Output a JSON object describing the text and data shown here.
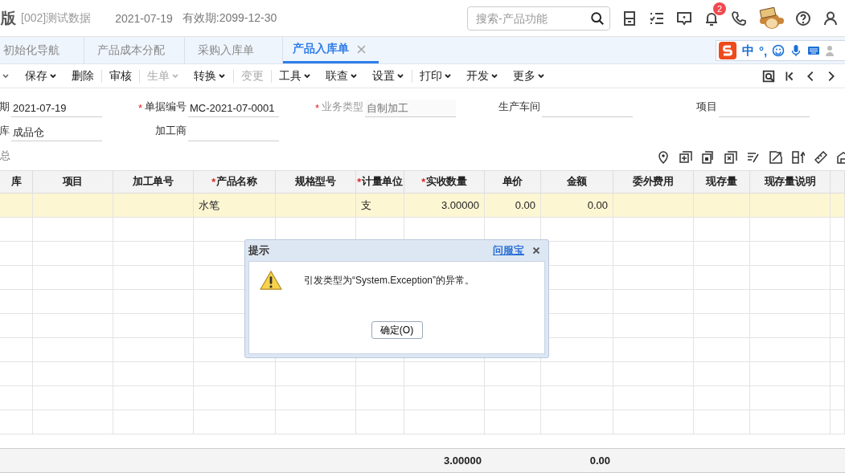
{
  "header": {
    "edition": "版",
    "account": "[002]测试数据",
    "date": "2021-07-19",
    "validity": "有效期:2099-12-30",
    "search": {
      "placeholder": "搜索-产品功能"
    },
    "notification_count": "2"
  },
  "tabs": [
    {
      "label": "初始化导航",
      "selected": false,
      "closable": false
    },
    {
      "label": "产品成本分配",
      "selected": false,
      "closable": false
    },
    {
      "label": "采购入库单",
      "selected": false,
      "closable": false
    },
    {
      "label": "产品入库单",
      "selected": true,
      "closable": true
    }
  ],
  "ime": {
    "mode": "中",
    "punctuation": "°,"
  },
  "toolbar": [
    {
      "label": "保存",
      "dropdown": true,
      "disabled": false,
      "separator_before": false
    },
    {
      "label": "删除",
      "dropdown": false,
      "disabled": false,
      "separator_before": false
    },
    {
      "label": "审核",
      "dropdown": false,
      "disabled": false,
      "separator_before": true
    },
    {
      "label": "生单",
      "dropdown": true,
      "disabled": true,
      "separator_before": true
    },
    {
      "label": "转换",
      "dropdown": true,
      "disabled": false,
      "separator_before": false
    },
    {
      "label": "变更",
      "dropdown": false,
      "disabled": true,
      "separator_before": true
    },
    {
      "label": "工具",
      "dropdown": true,
      "disabled": false,
      "separator_before": true
    },
    {
      "label": "联查",
      "dropdown": true,
      "disabled": false,
      "separator_before": false
    },
    {
      "label": "设置",
      "dropdown": true,
      "disabled": false,
      "separator_before": false
    },
    {
      "label": "打印",
      "dropdown": true,
      "disabled": false,
      "separator_before": true
    },
    {
      "label": "开发",
      "dropdown": true,
      "disabled": false,
      "separator_before": false
    },
    {
      "label": "更多",
      "dropdown": true,
      "disabled": false,
      "separator_before": false
    }
  ],
  "form": [
    [
      {
        "label": "期",
        "value": "2021-07-19",
        "disabled": false
      },
      {
        "label": "单据编号",
        "value": "MC-2021-07-0001",
        "required_mark": "*",
        "disabled": false
      },
      {
        "label": "业务类型",
        "value": "自制加工",
        "required_mark": "*",
        "disabled": true
      },
      {
        "label": "生产车间",
        "disabled": false
      },
      {
        "label": "项目",
        "disabled": false
      }
    ],
    [
      {
        "label": "库",
        "value": "成品仓",
        "disabled": false
      },
      {
        "label": "加工商",
        "disabled": false
      }
    ]
  ],
  "section_label": "总",
  "table": {
    "columns": [
      {
        "label": "库"
      },
      {
        "label": "项目"
      },
      {
        "label": "加工单号"
      },
      {
        "label": "产品名称",
        "required_mark": "*"
      },
      {
        "label": "规格型号"
      },
      {
        "label": "计量单位",
        "required_mark": "*"
      },
      {
        "label": "实收数量",
        "required_mark": "*"
      },
      {
        "label": "单价"
      },
      {
        "label": "金额"
      },
      {
        "label": "委外费用"
      },
      {
        "label": "现存量"
      },
      {
        "label": "现存量说明"
      }
    ],
    "rows": [
      {
        "product_name": "水笔",
        "unit": "支",
        "quantity": "3.00000",
        "price": "0.00",
        "amount": "0.00",
        "selected": true
      }
    ],
    "totals": {
      "quantity": "3.00000",
      "amount": "0.00"
    }
  },
  "dialog": {
    "title": "提示",
    "help_link": "问服宝",
    "message": "引发类型为“System.Exception”的异常。",
    "button": "确定(O)"
  }
}
